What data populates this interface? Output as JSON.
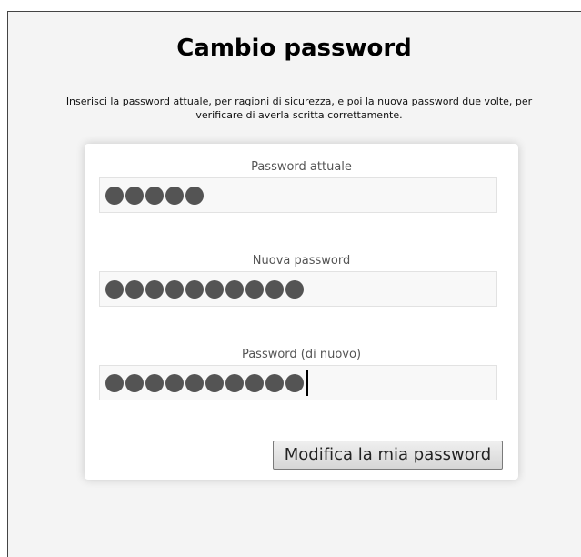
{
  "page": {
    "title": "Cambio password",
    "intro": "Inserisci la password attuale, per ragioni di sicurezza, e poi la nuova password due volte, per verificare di averla scritta correttamente."
  },
  "form": {
    "fields": [
      {
        "label": "Password attuale",
        "masked_length": 5,
        "focused": false
      },
      {
        "label": "Nuova password",
        "masked_length": 10,
        "focused": false
      },
      {
        "label": "Password (di nuovo)",
        "masked_length": 10,
        "focused": true
      }
    ],
    "submit_label": "Modifica la mia password"
  },
  "colors": {
    "background": "#f4f4f4",
    "card": "#ffffff",
    "mask_dot": "#545454"
  }
}
